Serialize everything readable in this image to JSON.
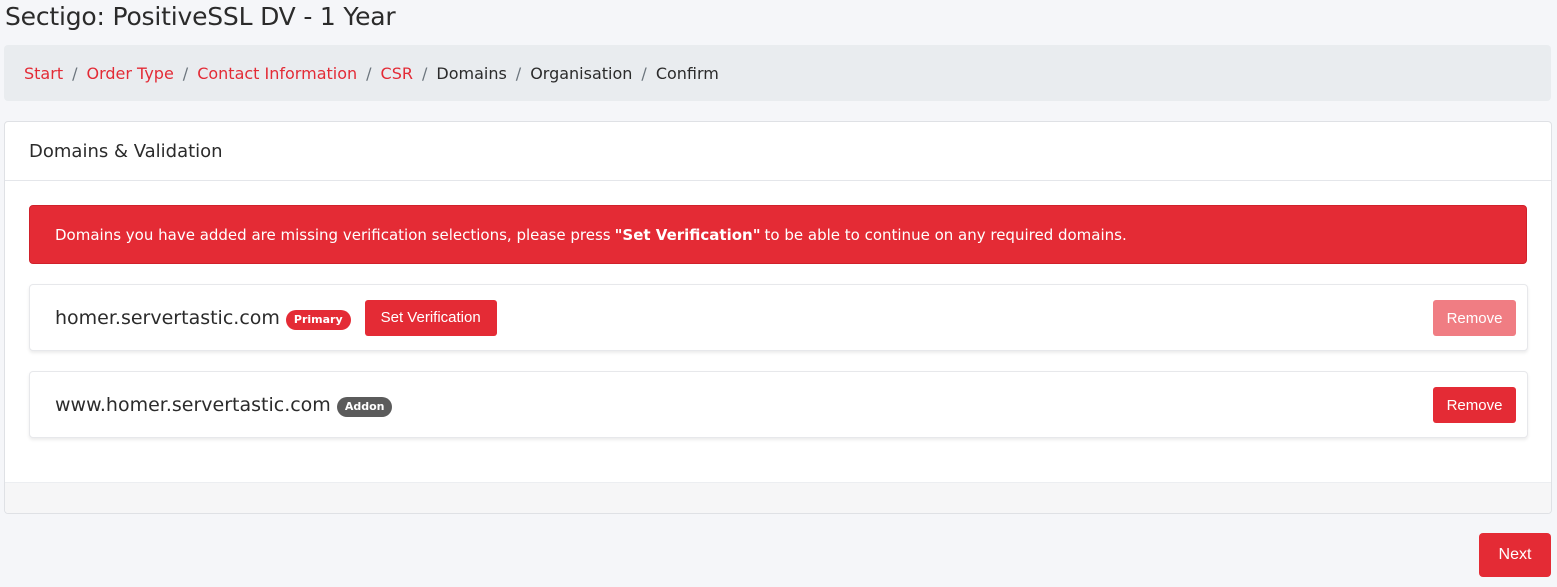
{
  "page": {
    "title": "Sectigo: PositiveSSL DV - 1 Year"
  },
  "breadcrumb": {
    "separator": "/",
    "items": [
      {
        "label": "Start",
        "link": true
      },
      {
        "label": "Order Type",
        "link": true
      },
      {
        "label": "Contact Information",
        "link": true
      },
      {
        "label": "CSR",
        "link": true
      },
      {
        "label": "Domains",
        "link": false
      },
      {
        "label": "Organisation",
        "link": false
      },
      {
        "label": "Confirm",
        "link": false
      }
    ]
  },
  "card": {
    "title": "Domains & Validation",
    "alert": {
      "before": "Domains you have added are missing verification selections, please press",
      "emphasis": "\"Set Verification\"",
      "after": "to be able to continue on any required domains."
    },
    "domains": [
      {
        "name": "homer.servertastic.com",
        "badge": "Primary",
        "set_verification_label": "Set Verification",
        "remove_label": "Remove"
      },
      {
        "name": "www.homer.servertastic.com",
        "badge": "Addon",
        "remove_label": "Remove"
      }
    ]
  },
  "actions": {
    "next_label": "Next"
  },
  "colors": {
    "accent": "#e42b35",
    "addon_badge": "#5b5b5b",
    "background": "#f5f6f9"
  }
}
